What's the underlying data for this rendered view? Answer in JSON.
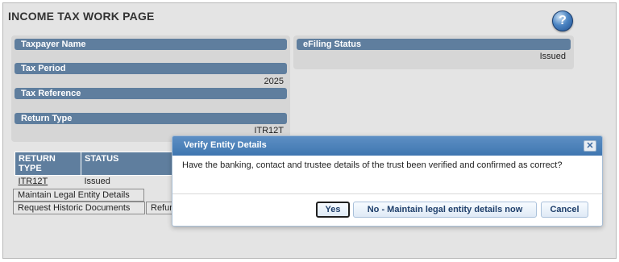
{
  "page": {
    "title": "INCOME TAX WORK PAGE",
    "help_icon": "help-icon"
  },
  "taxpayer_panel": {
    "name_label": "Taxpayer Name",
    "name_value": "",
    "period_label": "Tax Period",
    "period_value": "2025",
    "reference_label": "Tax Reference",
    "reference_value": "",
    "return_type_label": "Return Type",
    "return_type_value": "ITR12T"
  },
  "efiling_panel": {
    "label": "eFiling Status",
    "value": "Issued"
  },
  "returns_table": {
    "headers": [
      "RETURN TYPE",
      "STATUS"
    ],
    "rows": [
      {
        "return_type": "ITR12T",
        "status": "Issued"
      }
    ]
  },
  "actions": {
    "maintain_entity": "Maintain Legal Entity Details",
    "request_docs": "Request Historic Documents",
    "refund": "Refun"
  },
  "modal": {
    "title": "Verify Entity Details",
    "close_icon": "close-icon",
    "message": "Have the banking, contact and trustee details of the trust been verified and confirmed as correct?",
    "yes_label": "Yes",
    "no_label": "No - Maintain legal entity details now",
    "cancel_label": "Cancel"
  }
}
